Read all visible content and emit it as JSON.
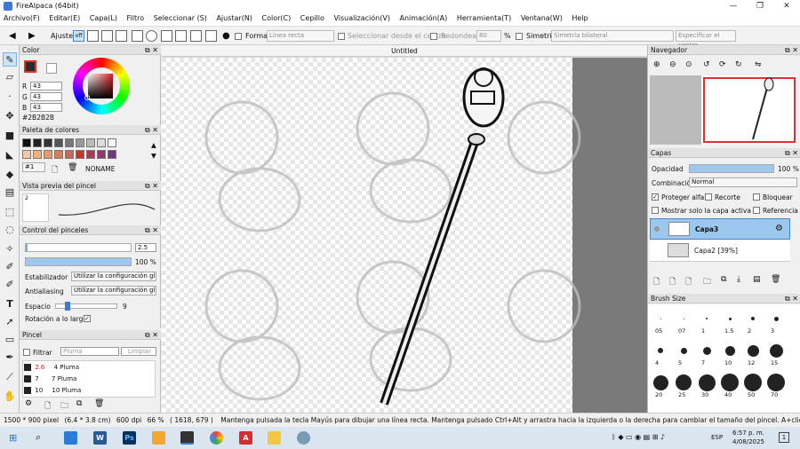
{
  "window": {
    "title": "FireAlpaca (64bit)",
    "minimize": "—",
    "maximize": "❐",
    "close": "✕"
  },
  "menu": [
    "Archivo(F)",
    "Editar(E)",
    "Capa(L)",
    "Filtro",
    "Seleccionar (S)",
    "Ajustar(N)",
    "Color(C)",
    "Cepillo",
    "Visualización(V)",
    "Animación(A)",
    "Herramienta(T)",
    "Ventana(W)",
    "Help"
  ],
  "toolbar": {
    "ajuste": "Ajuste",
    "off": "off",
    "forma": "Forma",
    "forma_value": "Línea recta",
    "select_center": "Seleccionar desde el centro",
    "redondear": "Redondear",
    "redondear_value": "80",
    "percent": "%",
    "simetria": "Simetría",
    "simetria_value": "Simetría bilateral",
    "specify_center": "Especificar el centro"
  },
  "color_panel": {
    "title": "Color",
    "r_label": "R",
    "r": "43",
    "g_label": "G",
    "g": "43",
    "b_label": "B",
    "b": "43",
    "hex": "#2B2B2B",
    "fg_color": "#2b2b2b"
  },
  "palette_panel": {
    "title": "Paleta de colores",
    "index": "#1",
    "name": "NONAME",
    "row1": [
      "#111111",
      "#222222",
      "#333333",
      "#555555",
      "#777777",
      "#999999",
      "#bbbbbb",
      "#dddddd",
      "#f5f5f5"
    ],
    "row2": [
      "#f2c9a8",
      "#f0b080",
      "#e89a6a",
      "#d97c5c",
      "#c56a5a",
      "#c0392b",
      "#a83b55",
      "#8e3a6e",
      "#6e3a7e"
    ]
  },
  "brush_preview": {
    "title": "Vista previa del pincel",
    "value": "2"
  },
  "brush_control": {
    "title": "Control del pinceles",
    "size": "2.5",
    "opacity": "100 %",
    "opacity_fraction": 1.0,
    "estabilizador_label": "Estabilizador",
    "estabilizador_value": "Utilizar la configuración gl",
    "antialiasing_label": "Antialiasing",
    "antialiasing_value": "Utilizar la configuración gl",
    "espacio_label": "Espacio",
    "espacio_value": "9",
    "rotacion_label": "Rotación a lo largo"
  },
  "pincel_panel": {
    "title": "Pincel",
    "filtrar": "Filtrar",
    "search_placeholder": "Pluma",
    "clear": "Limpiar",
    "items": [
      {
        "size": "2.6",
        "name": "4 Pluma"
      },
      {
        "size": "7",
        "name": "7 Pluma"
      },
      {
        "size": "10",
        "name": "10 Pluma"
      }
    ]
  },
  "document": {
    "tab": "Untitled"
  },
  "navigator": {
    "title": "Navegador"
  },
  "layers_panel": {
    "title": "Capas",
    "opacity_label": "Opacidad",
    "opacity_value": "100 %",
    "opacity_fraction": 1.0,
    "blend_label": "Combinación",
    "blend_value": "Normal",
    "protect_alpha": "Proteger alfa",
    "clip": "Recorte",
    "lock": "Bloquear",
    "show_active_only": "Mostrar solo la capa activa",
    "reference": "Referencia",
    "layers": [
      {
        "name": "Capa3"
      },
      {
        "name": "Capa2 [39%]"
      }
    ]
  },
  "brush_size": {
    "title": "Brush Size",
    "labels_row1": [
      "05",
      "07",
      "1",
      "1.5",
      "2",
      "3"
    ],
    "labels_row2": [
      "4",
      "5",
      "7",
      "10",
      "12",
      "15"
    ],
    "labels_row3": [
      "20",
      "25",
      "30",
      "40",
      "50",
      "70"
    ]
  },
  "status": {
    "dims": "1500 * 900 pixel",
    "cm": "(6.4 * 3.8 cm)",
    "dpi": "600 dpi",
    "zoom": "66 %",
    "cursor": "( 1618, 679 )",
    "hint": "Mantenga pulsada la tecla Mayús para dibujar una línea recta. Mantenga pulsado Ctrl+Alt y arrastra hacia la izquierda o la derecha para cambiar el tamaño del pincel. A+clic para activar la capa."
  },
  "taskbar": {
    "lang": "ESP",
    "time": "6:57 p. m.",
    "date": "4/08/2025",
    "notif": "1"
  }
}
